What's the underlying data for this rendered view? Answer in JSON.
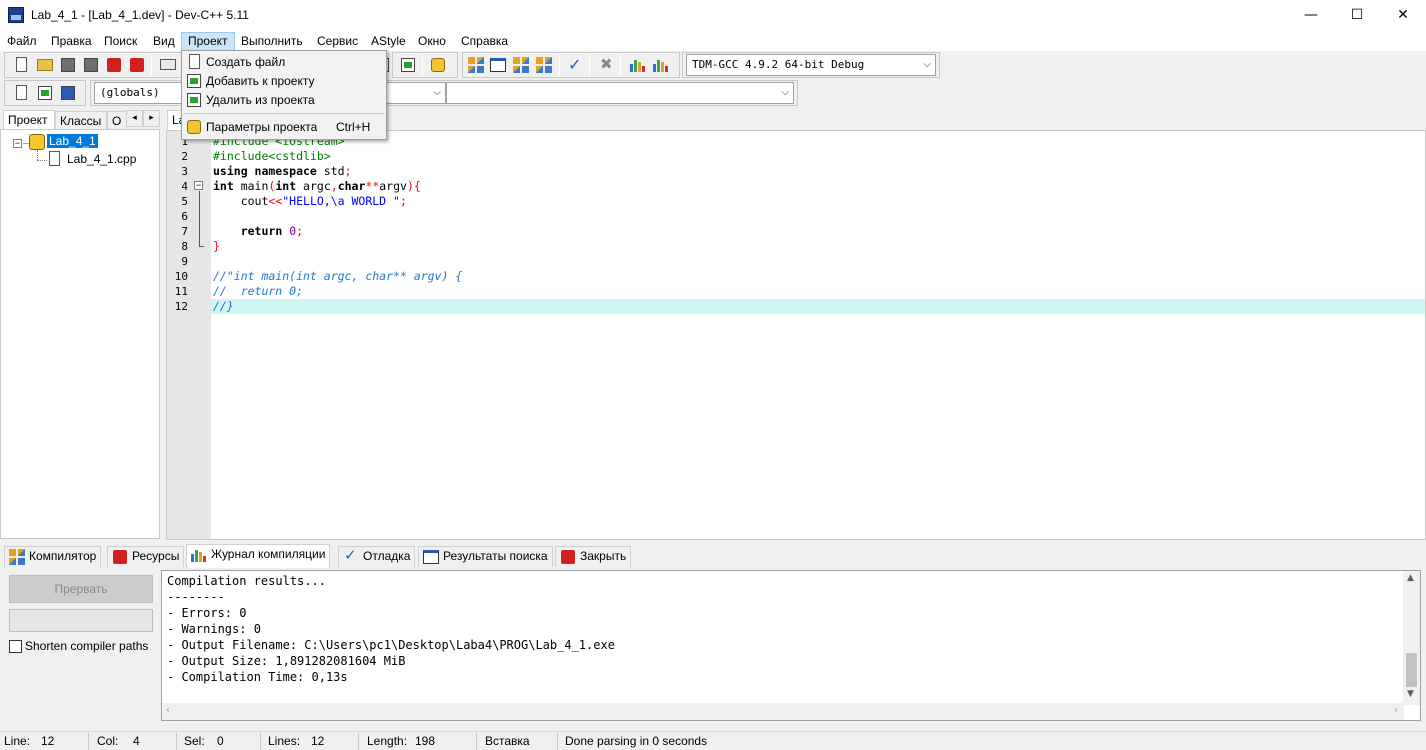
{
  "window": {
    "title": "Lab_4_1 - [Lab_4_1.dev] - Dev-C++ 5.11",
    "app_icon_text": "DEV",
    "minimize_glyph": "—",
    "maximize_glyph": "☐",
    "close_glyph": "✕"
  },
  "menu": [
    "Файл",
    "Правка",
    "Поиск",
    "Вид",
    "Проект",
    "Выполнить",
    "Сервис",
    "AStyle",
    "Окно",
    "Справка"
  ],
  "toolbar": {
    "compiler_select": "TDM-GCC 4.9.2 64-bit Debug",
    "scope_select": "(globals)",
    "symbol_select": ""
  },
  "dropdown": {
    "items": [
      {
        "label": "Создать файл",
        "shortcut": "",
        "icon": "new-file-icon"
      },
      {
        "label": "Добавить к проекту",
        "shortcut": "",
        "icon": "add-to-project-icon"
      },
      {
        "label": "Удалить из проекта",
        "shortcut": "",
        "icon": "remove-from-project-icon"
      },
      {
        "label": "Параметры проекта",
        "shortcut": "Ctrl+H",
        "icon": "project-options-icon"
      }
    ]
  },
  "left_panel": {
    "tabs": [
      "Проект",
      "Классы",
      "О"
    ],
    "tree": {
      "project": "Lab_4_1",
      "file": "Lab_4_1.cpp",
      "expander": "−"
    }
  },
  "editor": {
    "tab_label": "La",
    "fold_glyph": "−",
    "line_numbers": [
      "1",
      "2",
      "3",
      "4",
      "5",
      "6",
      "7",
      "8",
      "9",
      "10",
      "11",
      "12"
    ]
  },
  "bottom_tabs": [
    "Компилятор",
    "Ресурсы",
    "Журнал компиляции",
    "Отладка",
    "Результаты поиска",
    "Закрыть"
  ],
  "bottom_panel": {
    "abort_button": "Прервать",
    "shorten_paths_label": "Shorten compiler paths",
    "log": [
      "Compilation results...",
      "--------",
      "- Errors: 0",
      "- Warnings: 0",
      "- Output Filename: C:\\Users\\pc1\\Desktop\\Laba4\\PROG\\Lab_4_1.exe",
      "- Output Size: 1,891282081604 MiB",
      "- Compilation Time: 0,13s"
    ]
  },
  "status": {
    "line_label": "Line:",
    "line": "12",
    "col_label": "Col:",
    "col": "4",
    "sel_label": "Sel:",
    "sel": "0",
    "lines_label": "Lines:",
    "lines": "12",
    "length_label": "Length:",
    "length": "198",
    "mode": "Вставка",
    "message": "Done parsing in 0 seconds"
  },
  "colors": {
    "accent": "#0078d7",
    "menu_highlight": "#cce4f7",
    "current_line": "#cff5f5",
    "preprocessor": "#008000",
    "comment": "#2777c8",
    "string": "#0000ff",
    "operator": "#ff0000"
  }
}
